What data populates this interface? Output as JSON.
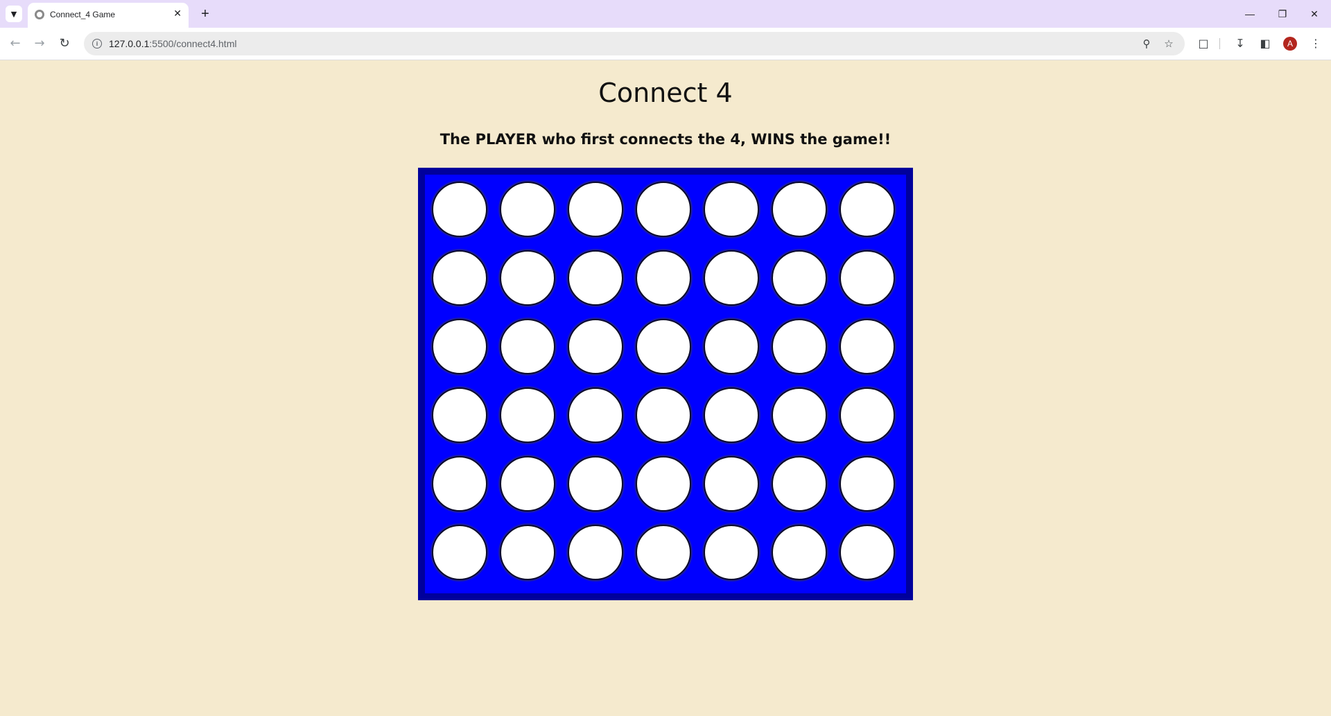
{
  "browser": {
    "tab_title": "Connect_4 Game",
    "tab_close": "✕",
    "new_tab": "+",
    "url_host": "127.0.0.1",
    "url_path": ":5500/connect4.html",
    "avatar_letter": "A",
    "window_controls": {
      "minimize": "—",
      "restore": "❐",
      "close": "✕"
    }
  },
  "page": {
    "title": "Connect 4",
    "subtitle": "The PLAYER who first connects the 4, WINS the game!!"
  },
  "board": {
    "rows": 6,
    "columns": 7,
    "frame_color": "#00009c",
    "board_color": "#0000ff",
    "empty_cell_color": "#ffffff",
    "cells": [
      [
        "empty",
        "empty",
        "empty",
        "empty",
        "empty",
        "empty",
        "empty"
      ],
      [
        "empty",
        "empty",
        "empty",
        "empty",
        "empty",
        "empty",
        "empty"
      ],
      [
        "empty",
        "empty",
        "empty",
        "empty",
        "empty",
        "empty",
        "empty"
      ],
      [
        "empty",
        "empty",
        "empty",
        "empty",
        "empty",
        "empty",
        "empty"
      ],
      [
        "empty",
        "empty",
        "empty",
        "empty",
        "empty",
        "empty",
        "empty"
      ],
      [
        "empty",
        "empty",
        "empty",
        "empty",
        "empty",
        "empty",
        "empty"
      ]
    ]
  },
  "colors": {
    "page_background": "#f5eace",
    "tab_strip": "#e7dcfa"
  }
}
